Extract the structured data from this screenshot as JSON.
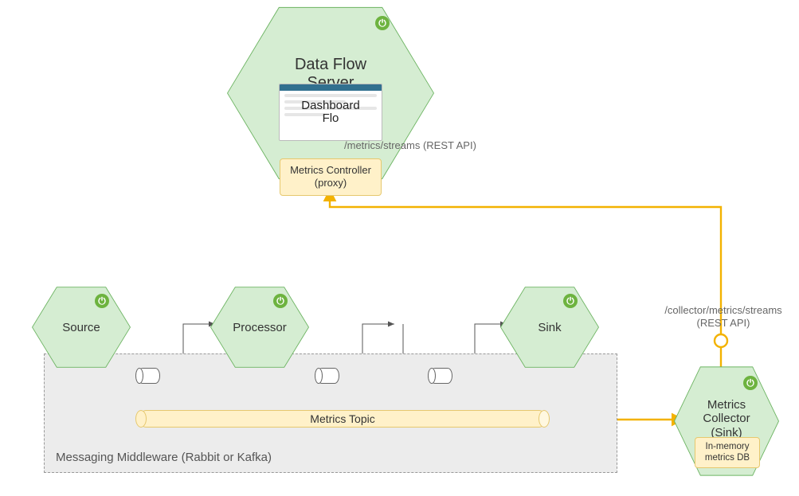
{
  "hexes": {
    "dataflow": {
      "title": "Data Flow\nServer",
      "dashboard_caption": "Dashboard\nFlo"
    },
    "source": {
      "title": "Source"
    },
    "processor": {
      "title": "Processor"
    },
    "sink": {
      "title": "Sink"
    },
    "collector": {
      "title": "Metrics\nCollector\n(Sink)",
      "db_label": "In-memory\nmetrics DB"
    }
  },
  "pills": {
    "controller": "Metrics Controller\n(proxy)"
  },
  "topic_label": "Metrics Topic",
  "middleware_caption": "Messaging Middleware (Rabbit or Kafka)",
  "edge_labels": {
    "metrics_api": "/metrics/streams (REST API)",
    "collector_api": "/collector/metrics/streams\n(REST API)"
  }
}
